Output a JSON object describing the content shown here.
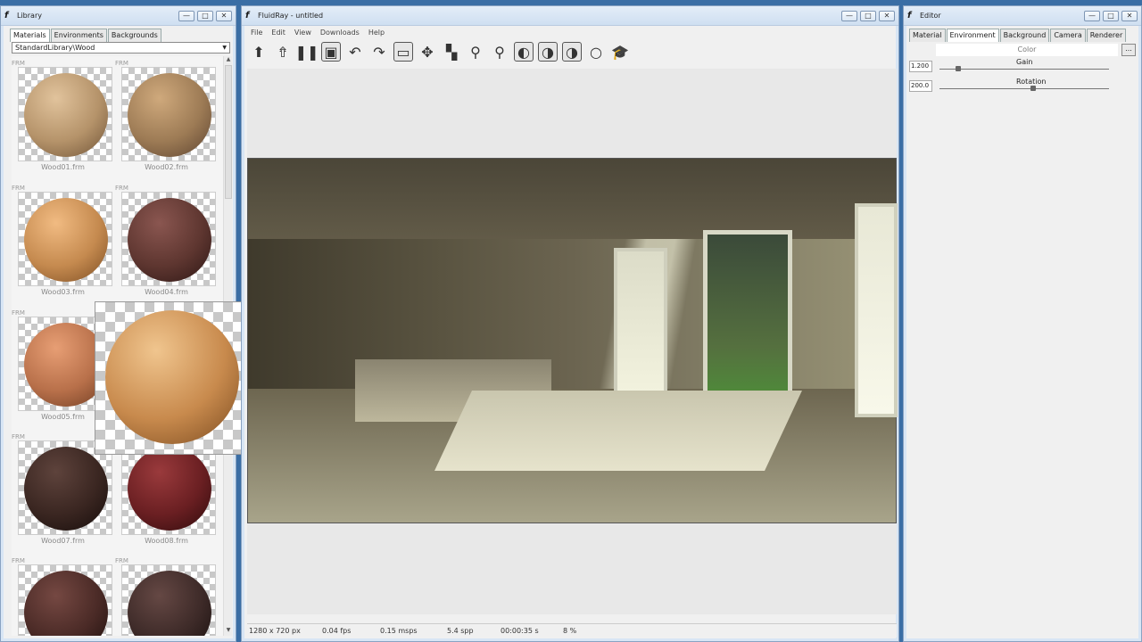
{
  "library": {
    "title": "Library",
    "tabs": [
      "Materials",
      "Environments",
      "Backgrounds"
    ],
    "path": "StandardLibrary\\Wood",
    "tag": "FRM",
    "items": [
      {
        "label": "Wood01.frm",
        "color": "#b5936a"
      },
      {
        "label": "Wood02.frm",
        "color": "#9d7b55"
      },
      {
        "label": "Wood03.frm",
        "color": "#c58a4f"
      },
      {
        "label": "Wood04.frm",
        "color": "#5e3630"
      },
      {
        "label": "Wood05.frm",
        "color": "#b8704a"
      },
      {
        "label": "Wood07.frm",
        "color": "#3a2621"
      },
      {
        "label": "Wood08.frm",
        "color": "#6a1f22"
      },
      {
        "label": "",
        "color": "#4a2a26"
      },
      {
        "label": "",
        "color": "#3d2a28"
      }
    ]
  },
  "main": {
    "title": "FluidRay - untitled",
    "menu": [
      "File",
      "Edit",
      "View",
      "Downloads",
      "Help"
    ],
    "status": {
      "resolution": "1280 x 720 px",
      "fps": "0.04 fps",
      "msps": "0.15 msps",
      "spp": "5.4 spp",
      "time": "00:00:35 s",
      "progress": "8 %"
    }
  },
  "editor": {
    "title": "Editor",
    "tabs": [
      "Material",
      "Environment",
      "Background",
      "Camera",
      "Renderer"
    ],
    "color_label": "Color",
    "color_button": "...",
    "gain": {
      "label": "Gain",
      "value": "1.200",
      "level": 0.11
    },
    "rotation": {
      "label": "Rotation",
      "value": "200.0",
      "level": 0.55
    }
  },
  "window_buttons": {
    "minimize": "—",
    "maximize": "□",
    "close": "✕"
  }
}
